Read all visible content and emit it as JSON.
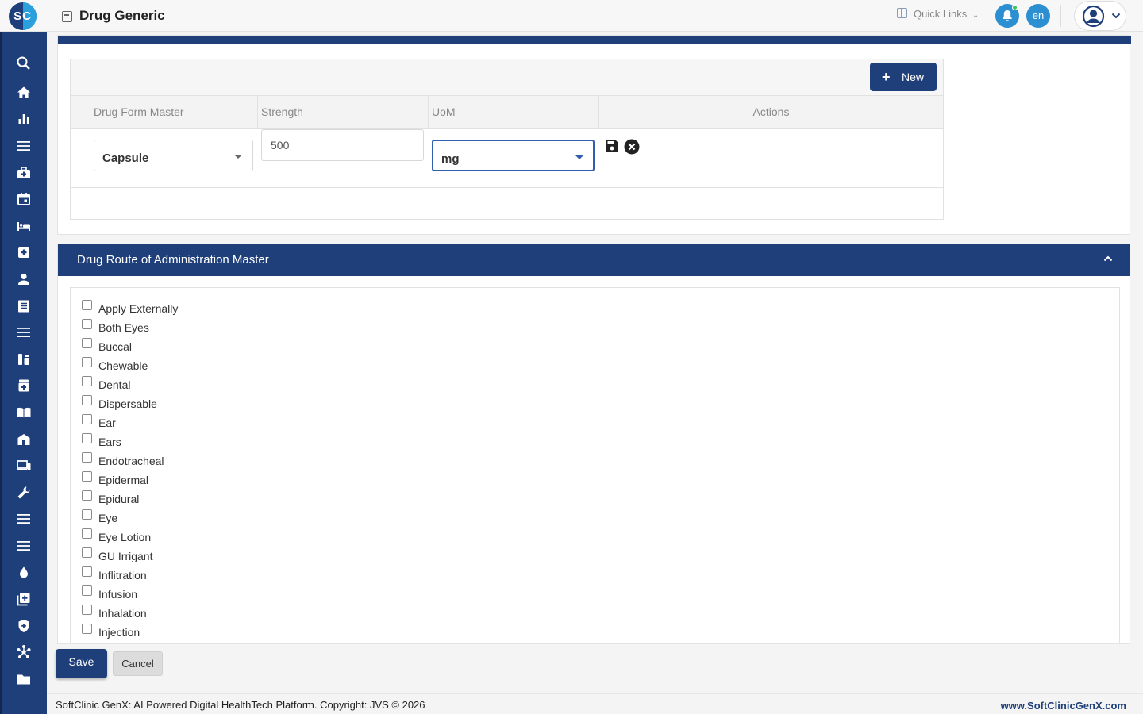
{
  "app": {
    "logo_text": "SC",
    "title": "Drug Generic"
  },
  "header": {
    "quick_links": "Quick Links",
    "quick_links_caret": "⌄",
    "language": "en"
  },
  "sidebar": {
    "icons": [
      "search-icon",
      "home-icon",
      "bar-chart-icon",
      "menu-icon",
      "medical-bag-icon",
      "calendar-icon",
      "bed-icon",
      "medical-cross-icon",
      "person-icon",
      "document-list-icon",
      "list-icon",
      "lab-icon",
      "pharmacy-icon",
      "book-icon",
      "building-icon",
      "devices-icon",
      "wrench-icon",
      "list-icon-2",
      "list-icon-3",
      "drop-icon",
      "add-box-icon",
      "shield-icon",
      "network-icon",
      "folder-icon"
    ]
  },
  "drug_form_grid": {
    "new_button": "New",
    "columns": [
      "Drug Form Master",
      "Strength",
      "UoM",
      "Actions"
    ],
    "row": {
      "drug_form": "Capsule",
      "strength": "500",
      "uom": "mg"
    }
  },
  "route_master": {
    "title": "Drug Route of Administration Master",
    "items": [
      "Apply Externally",
      "Both Eyes",
      "Buccal",
      "Chewable",
      "Dental",
      "Dispersable",
      "Ear",
      "Ears",
      "Endotracheal",
      "Epidermal",
      "Epidural",
      "Eye",
      "Eye Lotion",
      "GU Irrigant",
      "Inflitration",
      "Infusion",
      "Inhalation",
      "Injection"
    ]
  },
  "actions": {
    "save": "Save",
    "cancel": "Cancel"
  },
  "footer": {
    "copyright": "SoftClinic GenX: AI Powered Digital HealthTech Platform. Copyright: JVS © 2026",
    "website": "www.SoftClinicGenX.com"
  },
  "colors": {
    "brand": "#1f3f7a",
    "accent": "#2c8fd1"
  }
}
